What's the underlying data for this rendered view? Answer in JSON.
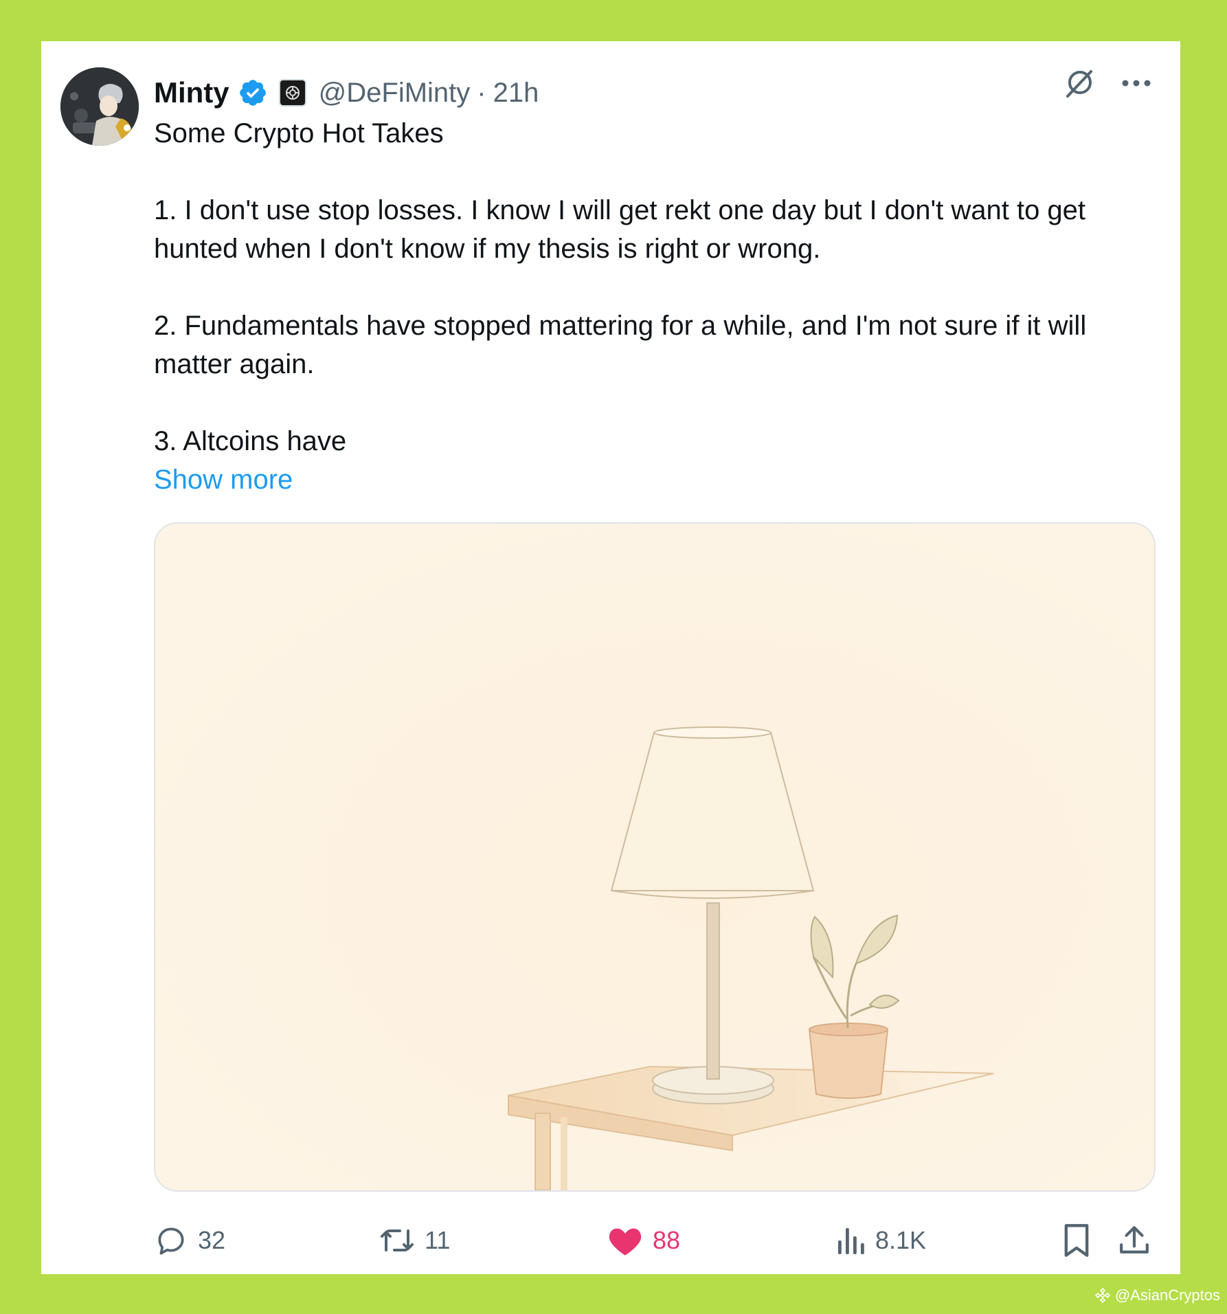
{
  "tweet": {
    "author": {
      "name": "Minty",
      "handle": "@DeFiMinty",
      "separator": "·",
      "time": "21h"
    },
    "text": {
      "line_title": "Some Crypto Hot Takes",
      "point1": "1. I don't use stop losses. I know I will get rekt one day but I don't want to get hunted when I don't know if my thesis is right or wrong.",
      "point2": "2. Fundamentals have stopped mattering for a while, and I'm not sure if it will matter again.",
      "point3": "3. Altcoins have",
      "show_more": "Show more"
    },
    "actions": {
      "replies": "32",
      "retweets": "11",
      "likes": "88",
      "views": "8.1K"
    },
    "colors": {
      "background": "#b5dd47",
      "link": "#1d9bf0",
      "like": "#e8346f",
      "muted": "#536471",
      "verified": "#1d9bf0"
    },
    "icons": [
      "reply-icon",
      "retweet-icon",
      "heart-icon",
      "views-icon",
      "bookmark-icon",
      "share-icon",
      "grok-icon",
      "more-icon",
      "verified-badge-icon"
    ]
  },
  "watermark": {
    "text": "@AsianCryptos"
  }
}
